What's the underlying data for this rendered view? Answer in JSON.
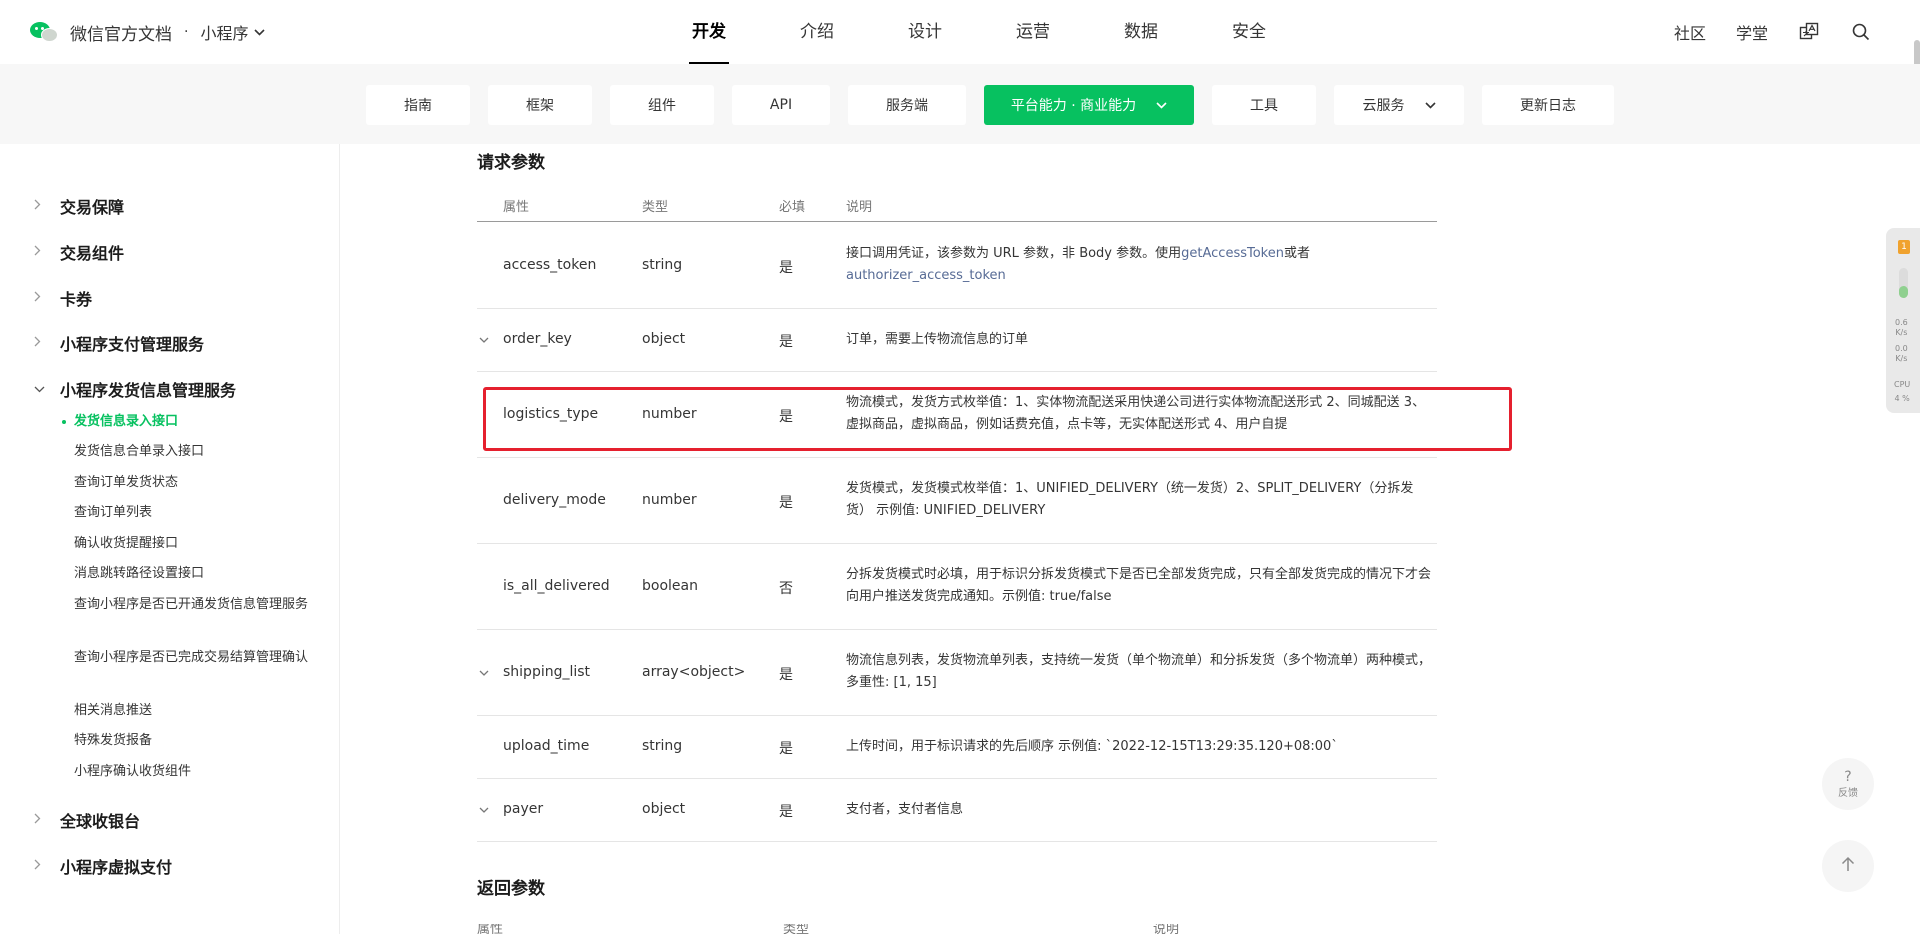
{
  "header": {
    "brand_title": "微信官方文档",
    "separator": "·",
    "product": "小程序",
    "nav": [
      "开发",
      "介绍",
      "设计",
      "运营",
      "数据",
      "安全"
    ],
    "active_nav": "开发",
    "right_links": [
      "社区",
      "学堂"
    ]
  },
  "subnav": {
    "items": [
      {
        "label": "指南"
      },
      {
        "label": "框架"
      },
      {
        "label": "组件"
      },
      {
        "label": "API"
      },
      {
        "label": "服务端"
      },
      {
        "label": "平台能力 · 商业能力"
      },
      {
        "label": "工具"
      },
      {
        "label": "云服务"
      },
      {
        "label": "更新日志"
      }
    ],
    "active": "平台能力 · 商业能力",
    "accent": "#07c160"
  },
  "sidebar": {
    "sections": [
      {
        "label": "交易保障",
        "expanded": false
      },
      {
        "label": "交易组件",
        "expanded": false
      },
      {
        "label": "卡券",
        "expanded": false
      },
      {
        "label": "小程序支付管理服务",
        "expanded": false
      },
      {
        "label": "小程序发货信息管理服务",
        "expanded": true
      },
      {
        "label": "全球收银台",
        "expanded": false
      },
      {
        "label": "小程序虚拟支付",
        "expanded": false
      }
    ],
    "sub_items": [
      {
        "label": "发货信息录入接口",
        "active": true
      },
      {
        "label": "发货信息合单录入接口"
      },
      {
        "label": "查询订单发货状态"
      },
      {
        "label": "查询订单列表"
      },
      {
        "label": "确认收货提醒接口"
      },
      {
        "label": "消息跳转路径设置接口"
      },
      {
        "label": "查询小程序是否已开通发货信息管理服务"
      },
      {
        "label": "查询小程序是否已完成交易结算管理确认"
      },
      {
        "label": "相关消息推送"
      },
      {
        "label": "特殊发货报备"
      },
      {
        "label": "小程序确认收货组件"
      }
    ]
  },
  "content": {
    "request_title": "请求参数",
    "columns": [
      "属性",
      "类型",
      "必填",
      "说明"
    ],
    "rows": [
      {
        "name": "access_token",
        "type": "string",
        "required": "是",
        "desc_a": "接口调用凭证，该参数为 URL 参数，非 Body 参数。使用",
        "desc_link1": "getAccessToken",
        "desc_b": "或者",
        "desc_link2": "authorizer_access_token",
        "expandable": false
      },
      {
        "name": "order_key",
        "type": "object",
        "required": "是",
        "desc": "订单，需要上传物流信息的订单",
        "expandable": true
      },
      {
        "name": "logistics_type",
        "type": "number",
        "required": "是",
        "desc": "物流模式，发货方式枚举值：1、实体物流配送采用快递公司进行实体物流配送形式 2、同城配送 3、虚拟商品，虚拟商品，例如话费充值，点卡等，无实体配送形式 4、用户自提",
        "expandable": false,
        "highlighted": true
      },
      {
        "name": "delivery_mode",
        "type": "number",
        "required": "是",
        "desc": "发货模式，发货模式枚举值：1、UNIFIED_DELIVERY（统一发货）2、SPLIT_DELIVERY（分拆发货） 示例值: UNIFIED_DELIVERY",
        "expandable": false
      },
      {
        "name": "is_all_delivered",
        "type": "boolean",
        "required": "否",
        "desc": "分拆发货模式时必填，用于标识分拆发货模式下是否已全部发货完成，只有全部发货完成的情况下才会向用户推送发货完成通知。示例值: true/false",
        "expandable": false
      },
      {
        "name": "shipping_list",
        "type": "array<object>",
        "required": "是",
        "desc": "物流信息列表，发货物流单列表，支持统一发货（单个物流单）和分拆发货（多个物流单）两种模式，多重性: [1, 15]",
        "expandable": true
      },
      {
        "name": "upload_time",
        "type": "string",
        "required": "是",
        "desc": "上传时间，用于标识请求的先后顺序 示例值: `2022-12-15T13:29:35.120+08:00`",
        "expandable": false
      },
      {
        "name": "payer",
        "type": "object",
        "required": "是",
        "desc": "支付者，支付者信息",
        "expandable": true
      }
    ],
    "response_title": "返回参数",
    "response_columns_partial": [
      "属性",
      "类型",
      "说明"
    ]
  },
  "monitor": {
    "up": "0.6",
    "up_unit": "K/s",
    "down": "0.0",
    "down_unit": "K/s",
    "cpu_label": "CPU",
    "cpu": "4 %"
  },
  "feedback": {
    "icon_text": "?",
    "label": "反馈"
  },
  "colors": {
    "accent": "#07c160",
    "highlight_border": "#e5202e",
    "link": "#576b95"
  }
}
